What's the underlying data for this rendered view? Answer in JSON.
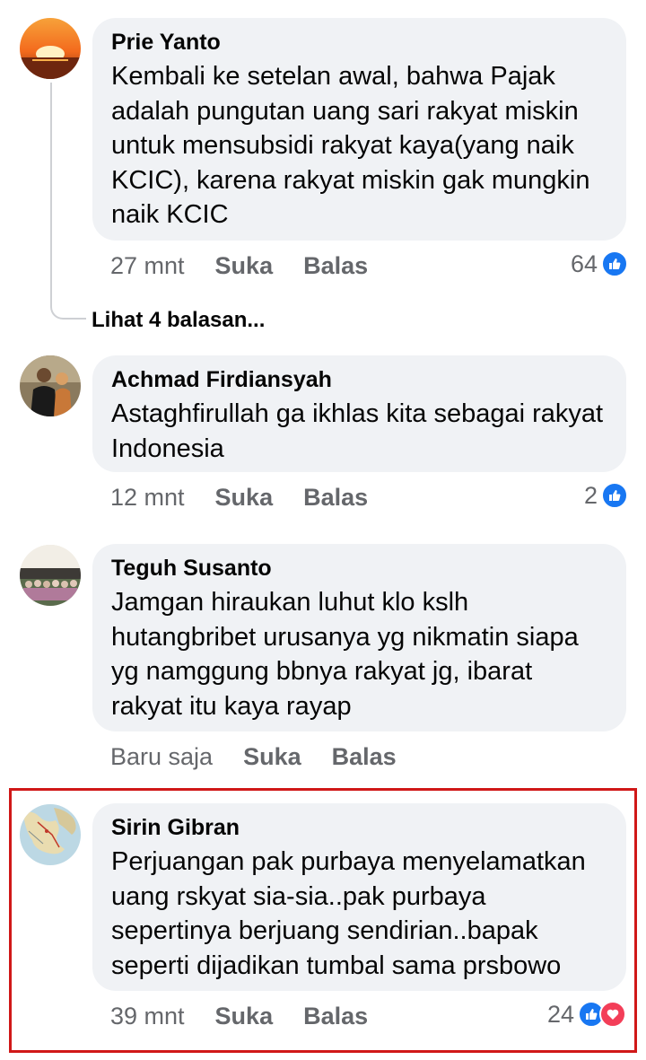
{
  "comments": [
    {
      "author": "Prie Yanto",
      "text": "Kembali ke setelan awal, bahwa Pajak adalah pungutan uang sari rakyat miskin untuk mensubsidi rakyat kaya(yang naik KCIC), karena rakyat miskin gak mungkin naik KCIC",
      "time": "27 mnt",
      "like_label": "Suka",
      "reply_label": "Balas",
      "reaction_count": "64",
      "reactions": [
        "like-icon"
      ],
      "view_replies": "Lihat 4 balasan..."
    },
    {
      "author": "Achmad Firdiansyah",
      "text": "Astaghfirullah ga ikhlas kita sebagai rakyat Indonesia",
      "time": "12 mnt",
      "like_label": "Suka",
      "reply_label": "Balas",
      "reaction_count": "2",
      "reactions": [
        "like-icon"
      ]
    },
    {
      "author": "Teguh Susanto",
      "text": "Jamgan hiraukan luhut klo kslh hutangbribet urusanya yg nikmatin siapa yg namggung bbnya rakyat jg, ibarat rakyat itu kaya rayap",
      "time": "Baru saja",
      "like_label": "Suka",
      "reply_label": "Balas"
    },
    {
      "author": "Sirin Gibran",
      "text": "Perjuangan pak purbaya menyelamatkan uang rskyat sia-sia..pak purbaya sepertinya berjuang sendirian..bapak seperti dijadikan tumbal sama prsbowo",
      "time": "39 mnt",
      "like_label": "Suka",
      "reply_label": "Balas",
      "reaction_count": "24",
      "reactions": [
        "like-icon",
        "love-icon"
      ]
    }
  ],
  "colors": {
    "bubble": "#f0f2f5",
    "meta_text": "#65676b",
    "like_blue": "#1877f2",
    "love_red": "#f33e58",
    "highlight_border": "#d01818"
  }
}
